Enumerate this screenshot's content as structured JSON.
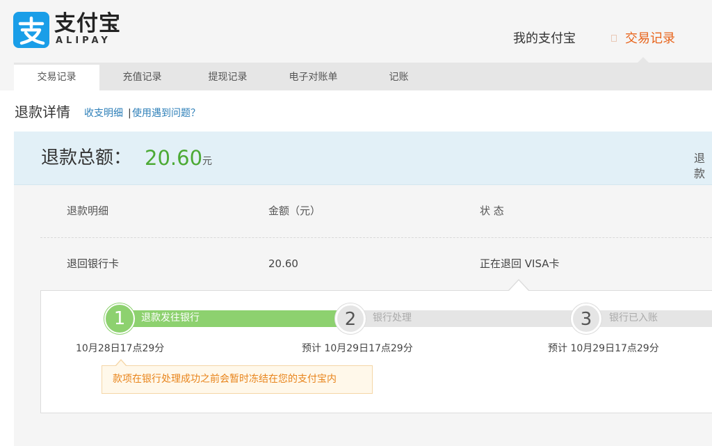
{
  "header": {
    "logo_cn": "支付宝",
    "logo_en": "ALIPAY",
    "nav_main": "我的支付宝",
    "nav_active": "交易记录"
  },
  "subnav": {
    "items": [
      {
        "label": "交易记录",
        "active": true
      },
      {
        "label": "充值记录",
        "active": false
      },
      {
        "label": "提现记录",
        "active": false
      },
      {
        "label": "电子对账单",
        "active": false
      },
      {
        "label": "记账",
        "active": false
      }
    ]
  },
  "page": {
    "title": "退款详情",
    "link_income": "收支明细",
    "separator": "|",
    "link_help": "使用遇到问题？"
  },
  "summary": {
    "label": "退款总额：",
    "amount": "20.60",
    "unit": "元",
    "right_text": "退款"
  },
  "table": {
    "headers": [
      "退款明细",
      "金额（元）",
      "状 态"
    ],
    "row": [
      "退回银行卡",
      "20.60",
      "正在退回 VISA卡"
    ]
  },
  "progress": {
    "steps": [
      {
        "number": "1",
        "label": "退款发往银行",
        "time": "10月28日17点29分",
        "done": true
      },
      {
        "number": "2",
        "label": "银行处理",
        "time": "预计 10月29日17点29分",
        "done": false
      },
      {
        "number": "3",
        "label": "银行已入账",
        "time": "预计 10月29日17点29分",
        "done": false
      }
    ],
    "note": "款项在银行处理成功之前会暂时冻结在您的支付宝内"
  },
  "colors": {
    "brand_blue": "#1a9ee8",
    "accent_orange": "#e8641b",
    "success_green": "#4caa35",
    "progress_green": "#8dd16f",
    "link_blue": "#2d7fb8"
  },
  "icons": [
    "alipay-logo-icon"
  ]
}
